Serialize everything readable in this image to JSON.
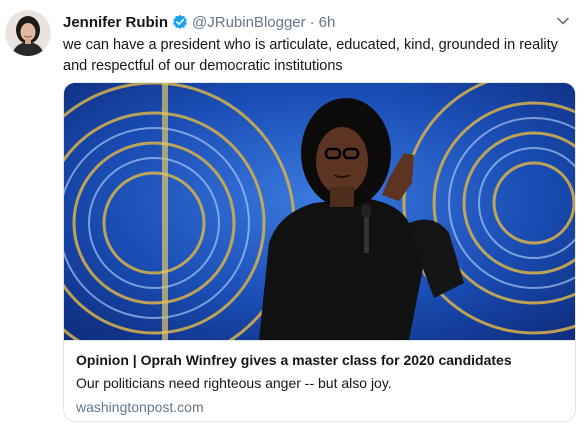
{
  "tweet": {
    "author": {
      "display_name": "Jennifer Rubin",
      "handle": "@JRubinBlogger",
      "avatar_icon": "profile-photo",
      "verified_icon": "verified-badge-icon",
      "verified_color": "#1da1f2"
    },
    "separator": "·",
    "time": "6h",
    "menu_icon": "chevron-down-icon",
    "text": "we can have a president who is articulate, educated, kind, grounded in reality and respectful of our democratic institutions",
    "card": {
      "image_description_icon": "photo",
      "title": "Opinion | Oprah Winfrey gives a master class for 2020 candidates",
      "description": "Our politicians need righteous anger -- but also joy.",
      "domain": "washingtonpost.com"
    }
  },
  "colors": {
    "text_primary": "#14171a",
    "text_secondary": "#657786",
    "border": "#e1e8ed",
    "stage_blue": "#1646a8",
    "ring_gold": "#d9b24a"
  }
}
